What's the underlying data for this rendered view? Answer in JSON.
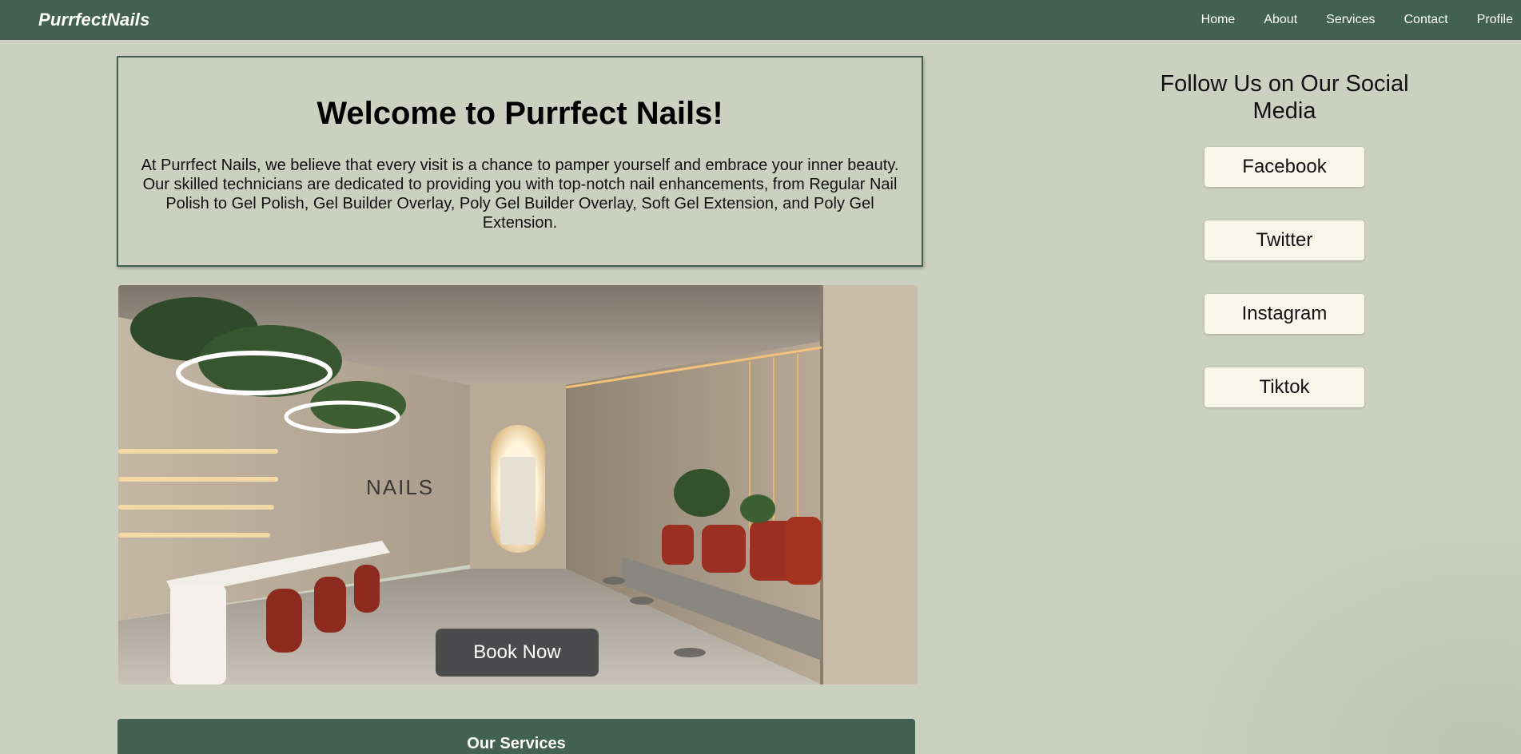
{
  "navbar": {
    "brand": "PurrfectNails",
    "links": [
      "Home",
      "About",
      "Services",
      "Contact",
      "Profile"
    ]
  },
  "welcome": {
    "title": "Welcome to Purrfect Nails!",
    "body": "At Purrfect Nails, we believe that every visit is a chance to pamper yourself and embrace your inner beauty. Our skilled technicians are dedicated to providing you with top-notch nail enhancements, from Regular Nail Polish to Gel Polish, Gel Builder Overlay, Poly Gel Builder Overlay, Soft Gel Extension, and Poly Gel Extension."
  },
  "hero": {
    "sign_text": "NAILS",
    "book_label": "Book Now"
  },
  "services": {
    "title": "Our Services"
  },
  "social": {
    "title": "Follow Us on Our Social Media",
    "buttons": [
      "Facebook",
      "Twitter",
      "Instagram",
      "Tiktok"
    ]
  },
  "colors": {
    "primary": "#436150",
    "background": "#ccd0c1",
    "button_light": "#f9f6ec",
    "button_dark": "#4b4b4d"
  }
}
